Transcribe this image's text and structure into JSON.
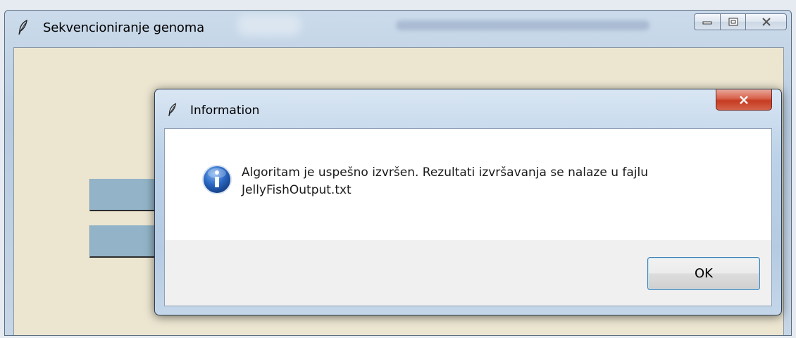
{
  "main_window": {
    "title": "Sekvencioniranje genoma",
    "icons": [
      "feather-icon",
      "minimize-icon",
      "maximize-icon",
      "close-icon"
    ]
  },
  "dialog": {
    "title": "Information",
    "message": "Algoritam je uspešno izvršen. Rezultati izvršavanja se nalaze u fajlu JellyFishOutput.txt",
    "ok_label": "OK",
    "icons": [
      "feather-icon",
      "close-icon",
      "info-icon"
    ]
  },
  "colors": {
    "client_background": "#ece6d1",
    "background_button": "#93b4c8",
    "close_button": "#c63c22",
    "info_icon": "#1f5fbf"
  }
}
